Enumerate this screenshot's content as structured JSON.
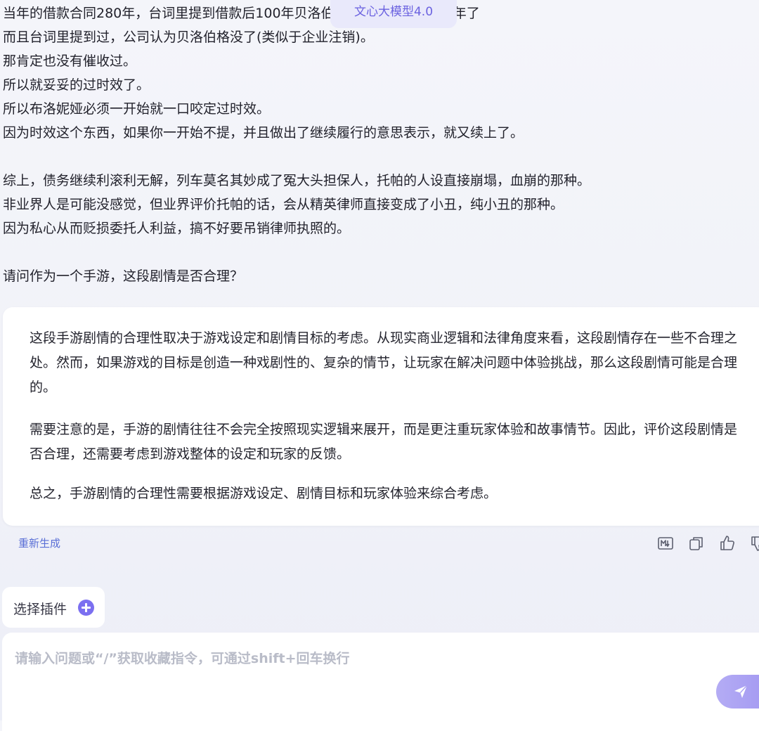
{
  "model_tag": "文心大模型4.0",
  "user_message": {
    "lines": [
      "当年的借款合同280年，台词里提到借款后100年贝洛伯格就已经经过去700年了",
      "而且台词里提到过，公司认为贝洛伯格没了(类似于企业注销)。",
      "那肯定也没有催收过。",
      "所以就妥妥的过时效了。",
      "所以布洛妮娅必须一开始就一口咬定过时效。",
      "因为时效这个东西，如果你一开始不提，并且做出了继续履行的意思表示，就又续上了。",
      "",
      "综上，债务继续利滚利无解，列车莫名其妙成了冤大头担保人，托帕的人设直接崩塌，血崩的那种。",
      "非业界人是可能没感觉，但业界评价托帕的话，会从精英律师直接变成了小丑，纯小丑的那种。",
      "因为私心从而贬损委托人利益，搞不好要吊销律师执照的。",
      "",
      "请问作为一个手游，这段剧情是否合理？"
    ]
  },
  "answer": {
    "p1": "这段手游剧情的合理性取决于游戏设定和剧情目标的考虑。从现实商业逻辑和法律角度来看，这段剧情存在一些不合理之处。然而，如果游戏的目标是创造一种戏剧性的、复杂的情节，让玩家在解决问题中体验挑战，那么这段剧情可能是合理的。",
    "p2": "需要注意的是，手游的剧情往往不会完全按照现实逻辑来展开，而是更注重玩家体验和故事情节。因此，评价这段剧情是否合理，还需要考虑到游戏整体的设定和玩家的反馈。",
    "p3": "总之，手游剧情的合理性需要根据游戏设定、剧情目标和玩家体验来综合考虑。"
  },
  "actions": {
    "regenerate_label": "重新生成",
    "icons": [
      "markdown-icon",
      "copy-icon",
      "thumbs-up-icon",
      "thumbs-down-icon"
    ]
  },
  "plugin": {
    "label": "选择插件"
  },
  "input": {
    "placeholder": "请输入问题或“/”获取收藏指令，可通过shift+回车换行",
    "value": ""
  },
  "colors": {
    "accent": "#7b6ff0",
    "link": "#5a6fd6",
    "send_button": "#a99ff3"
  }
}
